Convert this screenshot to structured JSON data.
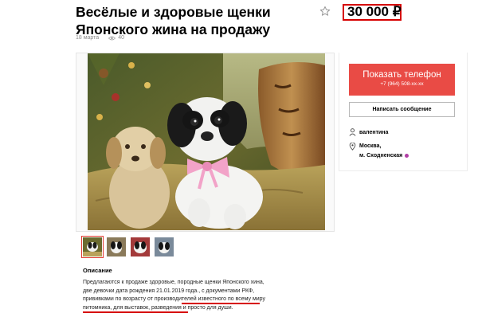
{
  "ad": {
    "title": "Весёлые и здоровые щенки Японского жина на продажу",
    "price": "30 000 ₽",
    "date": "18 марта",
    "views": "40"
  },
  "gallery": {
    "thumbnails": [
      "photo-1",
      "photo-2",
      "photo-3",
      "photo-4"
    ]
  },
  "description": {
    "heading": "Описание",
    "text": "Предлагаются к продаже здоровые, породные щенки Японского хина, две девочки дата рождения 21.01.2019 года., с документами РКФ, прививками по возрасту от производителей известного по всему миру питомника, для выставок, разведения и просто для души."
  },
  "contact": {
    "show_phone_label": "Показать телефон",
    "phone_masked": "+7 (964) 508-хх-хх",
    "message_label": "Написать сообщение",
    "seller_name": "валентина",
    "city": "Москва,",
    "metro": "м. Сходненская"
  },
  "colors": {
    "accent": "#e94b45",
    "highlight": "#d60000",
    "metro": "#b23fa6"
  },
  "icons": [
    "star-icon",
    "eye-icon",
    "user-icon",
    "location-pin-icon"
  ]
}
